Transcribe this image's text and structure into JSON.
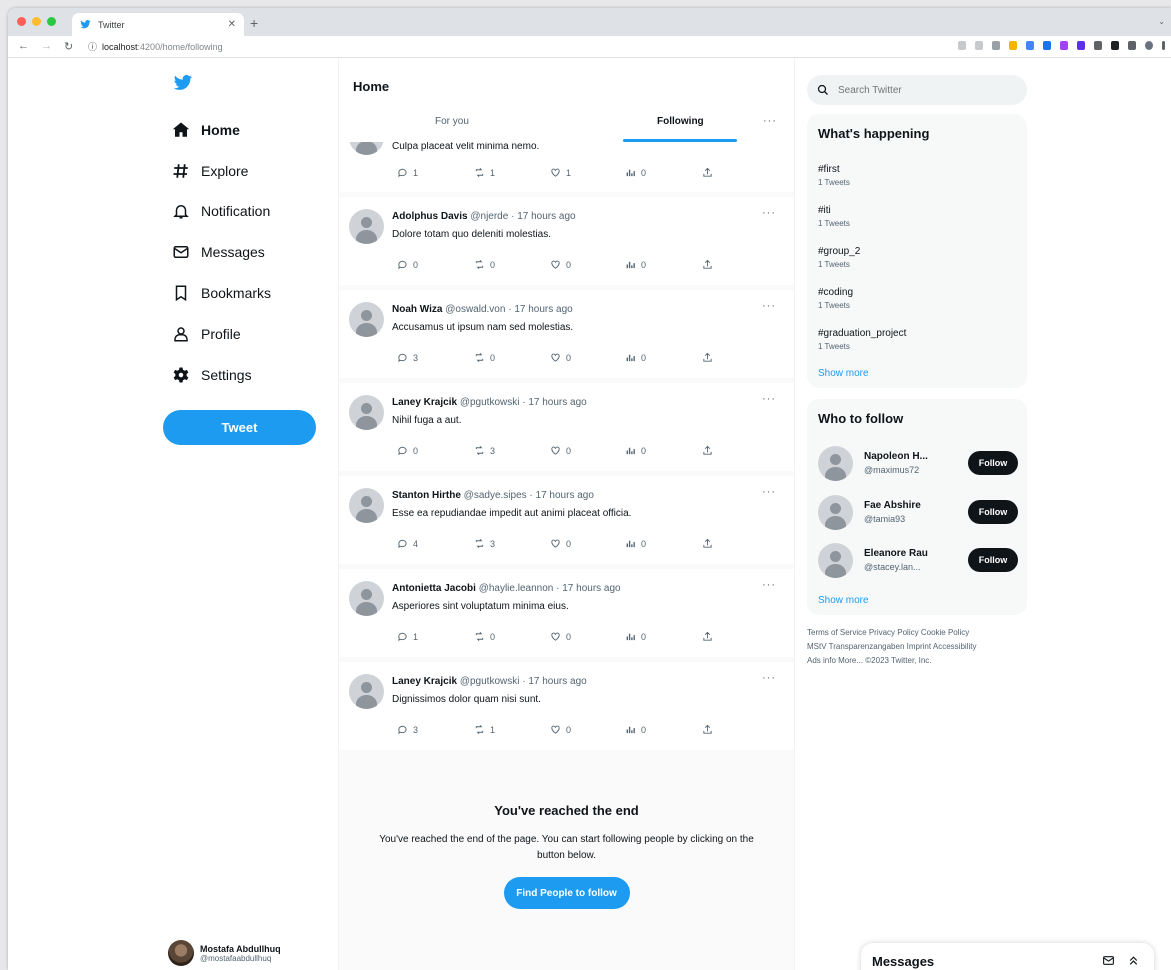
{
  "browser": {
    "tab_title": "Twitter",
    "new_tab": "+",
    "url_host": "localhost",
    "url_rest": ":4200/home/following"
  },
  "nav": {
    "items": [
      {
        "label": "Home",
        "icon": "home-icon"
      },
      {
        "label": "Explore",
        "icon": "hashtag-icon"
      },
      {
        "label": "Notification",
        "icon": "bell-icon"
      },
      {
        "label": "Messages",
        "icon": "envelope-icon"
      },
      {
        "label": "Bookmarks",
        "icon": "bookmark-icon"
      },
      {
        "label": "Profile",
        "icon": "user-icon"
      },
      {
        "label": "Settings",
        "icon": "gear-icon"
      }
    ],
    "tweet_button": "Tweet",
    "account": {
      "name": "Mostafa Abdullhuq",
      "handle": "@mostafaabdullhuq"
    }
  },
  "main": {
    "title": "Home",
    "tabs": [
      {
        "label": "For you"
      },
      {
        "label": "Following"
      }
    ],
    "active_tab": "Following",
    "more": "···",
    "tweets": [
      {
        "name": "",
        "handle": "",
        "time": "",
        "text": "Culpa placeat velit minima nemo.",
        "replies": "1",
        "retweets": "1",
        "likes": "1",
        "views": "0"
      },
      {
        "name": "Adolphus Davis",
        "handle": "@njerde",
        "time": "· 17 hours ago",
        "text": "Dolore totam quo deleniti molestias.",
        "replies": "0",
        "retweets": "0",
        "likes": "0",
        "views": "0"
      },
      {
        "name": "Noah Wiza",
        "handle": "@oswald.von",
        "time": "· 17 hours ago",
        "text": "Accusamus ut ipsum nam sed molestias.",
        "replies": "3",
        "retweets": "0",
        "likes": "0",
        "views": "0"
      },
      {
        "name": "Laney Krajcik",
        "handle": "@pgutkowski",
        "time": "· 17 hours ago",
        "text": "Nihil fuga a aut.",
        "replies": "0",
        "retweets": "3",
        "likes": "0",
        "views": "0"
      },
      {
        "name": "Stanton Hirthe",
        "handle": "@sadye.sipes",
        "time": "· 17 hours ago",
        "text": "Esse ea repudiandae impedit aut animi placeat officia.",
        "replies": "4",
        "retweets": "3",
        "likes": "0",
        "views": "0"
      },
      {
        "name": "Antonietta Jacobi",
        "handle": "@haylie.leannon",
        "time": "· 17 hours ago",
        "text": "Asperiores sint voluptatum minima eius.",
        "replies": "1",
        "retweets": "0",
        "likes": "0",
        "views": "0"
      },
      {
        "name": "Laney Krajcik",
        "handle": "@pgutkowski",
        "time": "· 17 hours ago",
        "text": "Dignissimos dolor quam nisi sunt.",
        "replies": "3",
        "retweets": "1",
        "likes": "0",
        "views": "0"
      }
    ],
    "end": {
      "title": "You've reached the end",
      "text": "You've reached the end of the page. You can start following people by clicking on the button below.",
      "button": "Find People to follow"
    }
  },
  "right": {
    "search_placeholder": "Search Twitter",
    "happening": {
      "title": "What's happening",
      "trends": [
        {
          "tag": "#first",
          "count": "1 Tweets"
        },
        {
          "tag": "#iti",
          "count": "1 Tweets"
        },
        {
          "tag": "#group_2",
          "count": "1 Tweets"
        },
        {
          "tag": "#coding",
          "count": "1 Tweets"
        },
        {
          "tag": "#graduation_project",
          "count": "1 Tweets"
        }
      ],
      "show_more": "Show more"
    },
    "who_to_follow": {
      "title": "Who to follow",
      "people": [
        {
          "name": "Napoleon H...",
          "handle": "@maximus72",
          "button": "Follow"
        },
        {
          "name": "Fae Abshire",
          "handle": "@tamia93",
          "button": "Follow"
        },
        {
          "name": "Eleanore Rau",
          "handle": "@stacey.lan...",
          "button": "Follow"
        }
      ],
      "show_more": "Show more"
    },
    "footer": [
      "Terms of Service",
      "Privacy Policy",
      "Cookie Policy",
      "MStV Transparenzangaben",
      "Imprint",
      "Accessibility",
      "Ads info",
      "More...",
      "©2023 Twitter, Inc."
    ]
  },
  "messages_dock": {
    "title": "Messages"
  },
  "colors": {
    "accent": "#1d9bf0",
    "text": "#0f1419",
    "muted": "#536471",
    "follow_button": "#0f1419"
  }
}
